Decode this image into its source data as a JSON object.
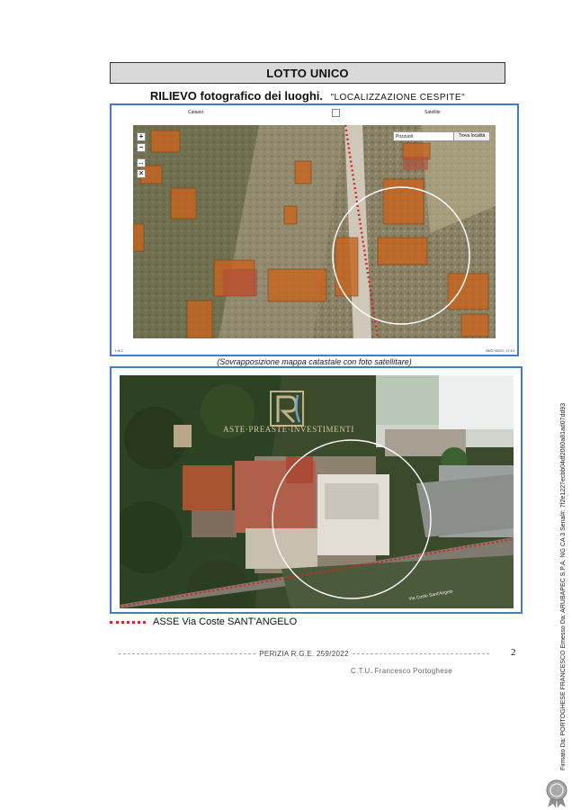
{
  "header": {
    "lotto": "LOTTO UNICO",
    "rilievo": "RILIEVO fotografico dei luoghi.",
    "localizzazione": "\"LOCALIZZAZIONE CESPITE\""
  },
  "map_panel": {
    "left_label": "Catasto",
    "right_label": "Satellite",
    "controls": [
      "+",
      "−",
      "↔",
      "×"
    ],
    "search_value": "Pozzuoli",
    "search_button": "Trova località",
    "page_marker": "1 di 2",
    "timestamp": "29/07/2023, 17:13",
    "caption": "(Sovrapposizione mappa catastale con foto satellitare)"
  },
  "satellite_panel": {
    "watermark": "ASTE·PREASTE·INVESTIMENTI",
    "street_label": "Via Coste Sant'Angelo"
  },
  "legend": {
    "text": "ASSE Via Coste SANT'ANGELO"
  },
  "footer": {
    "perizia": "PERIZIA  R.G.E. 259/2022",
    "page": "2",
    "author": "C.T.U. Francesco Portoghese"
  },
  "signature": {
    "text": "Firmato Da: PORTOGHESE FRANCESCO Emesso Da: ARUBAPEC S.P.A. NG CA 3 Serial#: 7f2e1227ecbb04df2060a81ad07dd93"
  },
  "colors": {
    "frame_border": "#4a79c5",
    "axis_line": "#d62424",
    "cadastral_fill": "#c8651e"
  },
  "icons": [
    "zoom-in-icon",
    "zoom-out-icon",
    "pan-icon",
    "close-icon",
    "seal-icon"
  ]
}
